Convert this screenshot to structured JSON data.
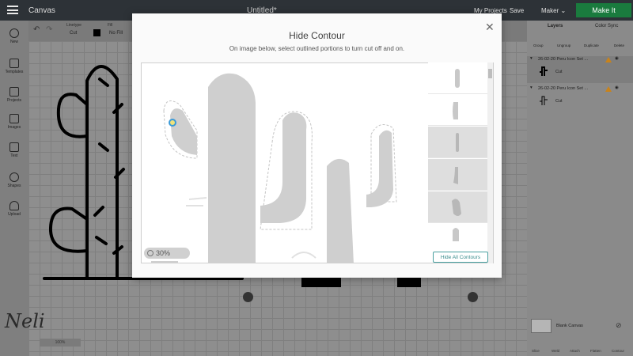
{
  "header": {
    "app_title": "Canvas",
    "doc_title": "Untitled*",
    "my_projects": "My Projects",
    "save": "Save",
    "machine": "Maker",
    "make_it": "Make It"
  },
  "toolbar": {
    "linetype_label": "Linetype",
    "linetype_value": "Cut",
    "fill_label": "Fill",
    "fill_value": "No Fill"
  },
  "sidebar": {
    "items": [
      {
        "label": "New",
        "icon": "plus-icon"
      },
      {
        "label": "Templates",
        "icon": "shirt-icon"
      },
      {
        "label": "Projects",
        "icon": "grid-icon"
      },
      {
        "label": "Images",
        "icon": "image-icon"
      },
      {
        "label": "Text",
        "icon": "text-icon"
      },
      {
        "label": "Shapes",
        "icon": "shapes-icon"
      },
      {
        "label": "Upload",
        "icon": "upload-icon"
      }
    ]
  },
  "right_panel": {
    "tabs": [
      "Layers",
      "Color Sync"
    ],
    "actions": [
      "Group",
      "Ungroup",
      "Duplicate",
      "Delete"
    ],
    "layers": [
      {
        "name": "26-02-20 Peru Icon Set ...",
        "sub": "Cut"
      },
      {
        "name": "26-02-20 Peru Icon Set ...",
        "sub": "Cut"
      }
    ],
    "blank_canvas": "Blank Canvas",
    "bottom_tools": [
      "Slice",
      "Weld",
      "Attach",
      "Flatten",
      "Contour"
    ]
  },
  "modal": {
    "title": "Hide Contour",
    "subtitle": "On image below, select outlined portions to turn cut off and on.",
    "zoom": "30%",
    "hide_all_button": "Hide All Contours"
  },
  "canvas": {
    "zoom": "100%",
    "signature": "Neli"
  },
  "colors": {
    "header_bg": "#2d3237",
    "make_it_green": "#1a7b3e",
    "accent_teal": "#3a8c8c",
    "warning": "#c9831a"
  }
}
